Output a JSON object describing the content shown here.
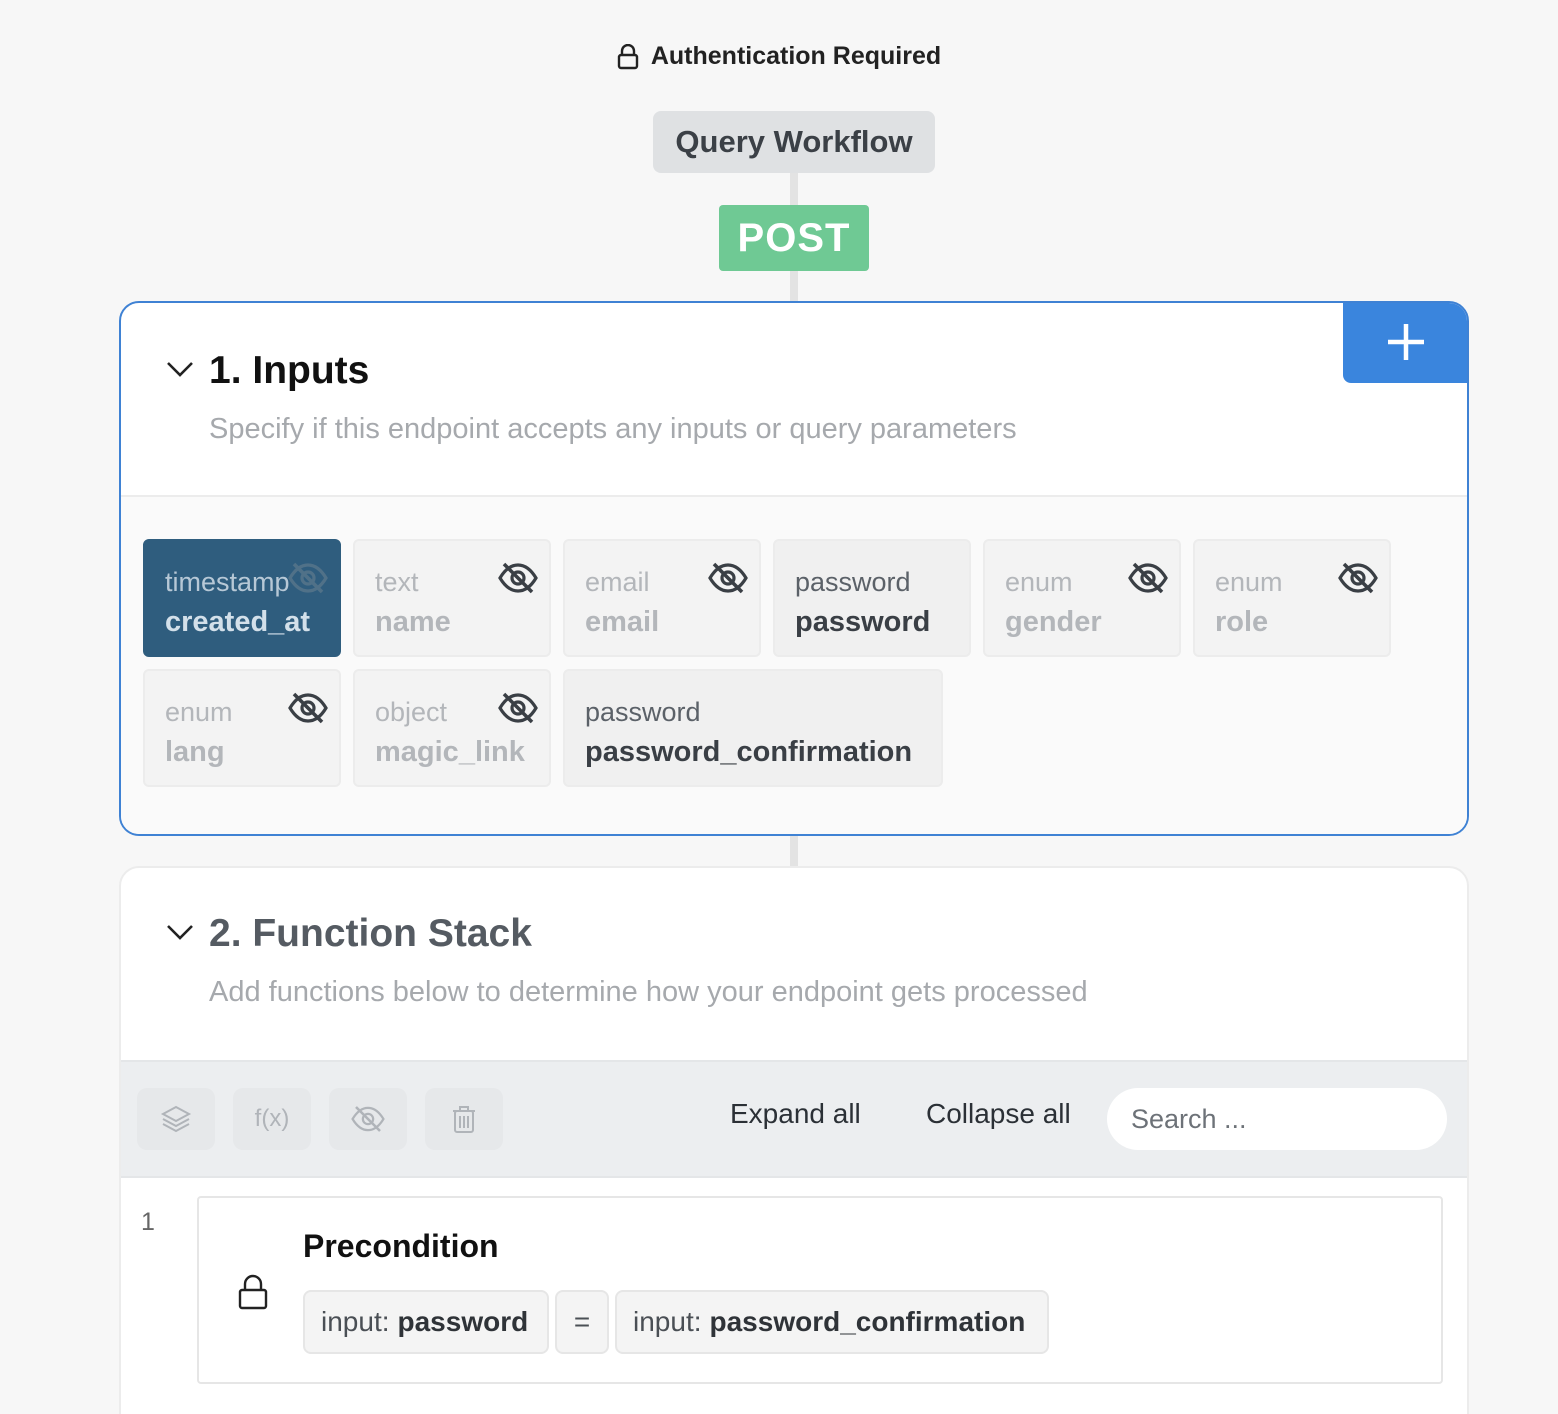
{
  "header": {
    "auth_label": "Authentication Required",
    "workflow_label": "Query Workflow",
    "method": "POST"
  },
  "inputs_section": {
    "title": "1. Inputs",
    "subtitle": "Specify if this endpoint accepts any inputs or query parameters",
    "add_icon": "plus-icon",
    "items": [
      {
        "type": "timestamp",
        "name": "created_at",
        "state": "selected",
        "hidden": true
      },
      {
        "type": "text",
        "name": "name",
        "state": "hidden",
        "hidden": true
      },
      {
        "type": "email",
        "name": "email",
        "state": "hidden",
        "hidden": true
      },
      {
        "type": "password",
        "name": "password",
        "state": "visible",
        "hidden": false
      },
      {
        "type": "enum",
        "name": "gender",
        "state": "hidden",
        "hidden": true
      },
      {
        "type": "enum",
        "name": "role",
        "state": "hidden",
        "hidden": true
      },
      {
        "type": "enum",
        "name": "lang",
        "state": "hidden",
        "hidden": true
      },
      {
        "type": "object",
        "name": "magic_link",
        "state": "hidden",
        "hidden": true
      },
      {
        "type": "password",
        "name": "password_confirmation",
        "state": "visible",
        "hidden": false
      }
    ]
  },
  "function_section": {
    "title": "2. Function Stack",
    "subtitle": "Add functions below to determine how your endpoint gets processed",
    "toolbar": {
      "tools": [
        "layers-icon",
        "function-icon",
        "eye-off-icon",
        "trash-icon"
      ],
      "function_glyph": "f(x)",
      "expand_all": "Expand all",
      "collapse_all": "Collapse all",
      "search_placeholder": "Search ..."
    },
    "steps": [
      {
        "number": "1",
        "title": "Precondition",
        "icon": "lock-icon",
        "left_prefix": "input:",
        "left_value": "password",
        "operator": "=",
        "right_prefix": "input:",
        "right_value": "password_confirmation"
      }
    ]
  },
  "colors": {
    "accent_blue": "#3a85dd",
    "post_green": "#6fc994",
    "selected_chip": "#2f5d7e"
  }
}
